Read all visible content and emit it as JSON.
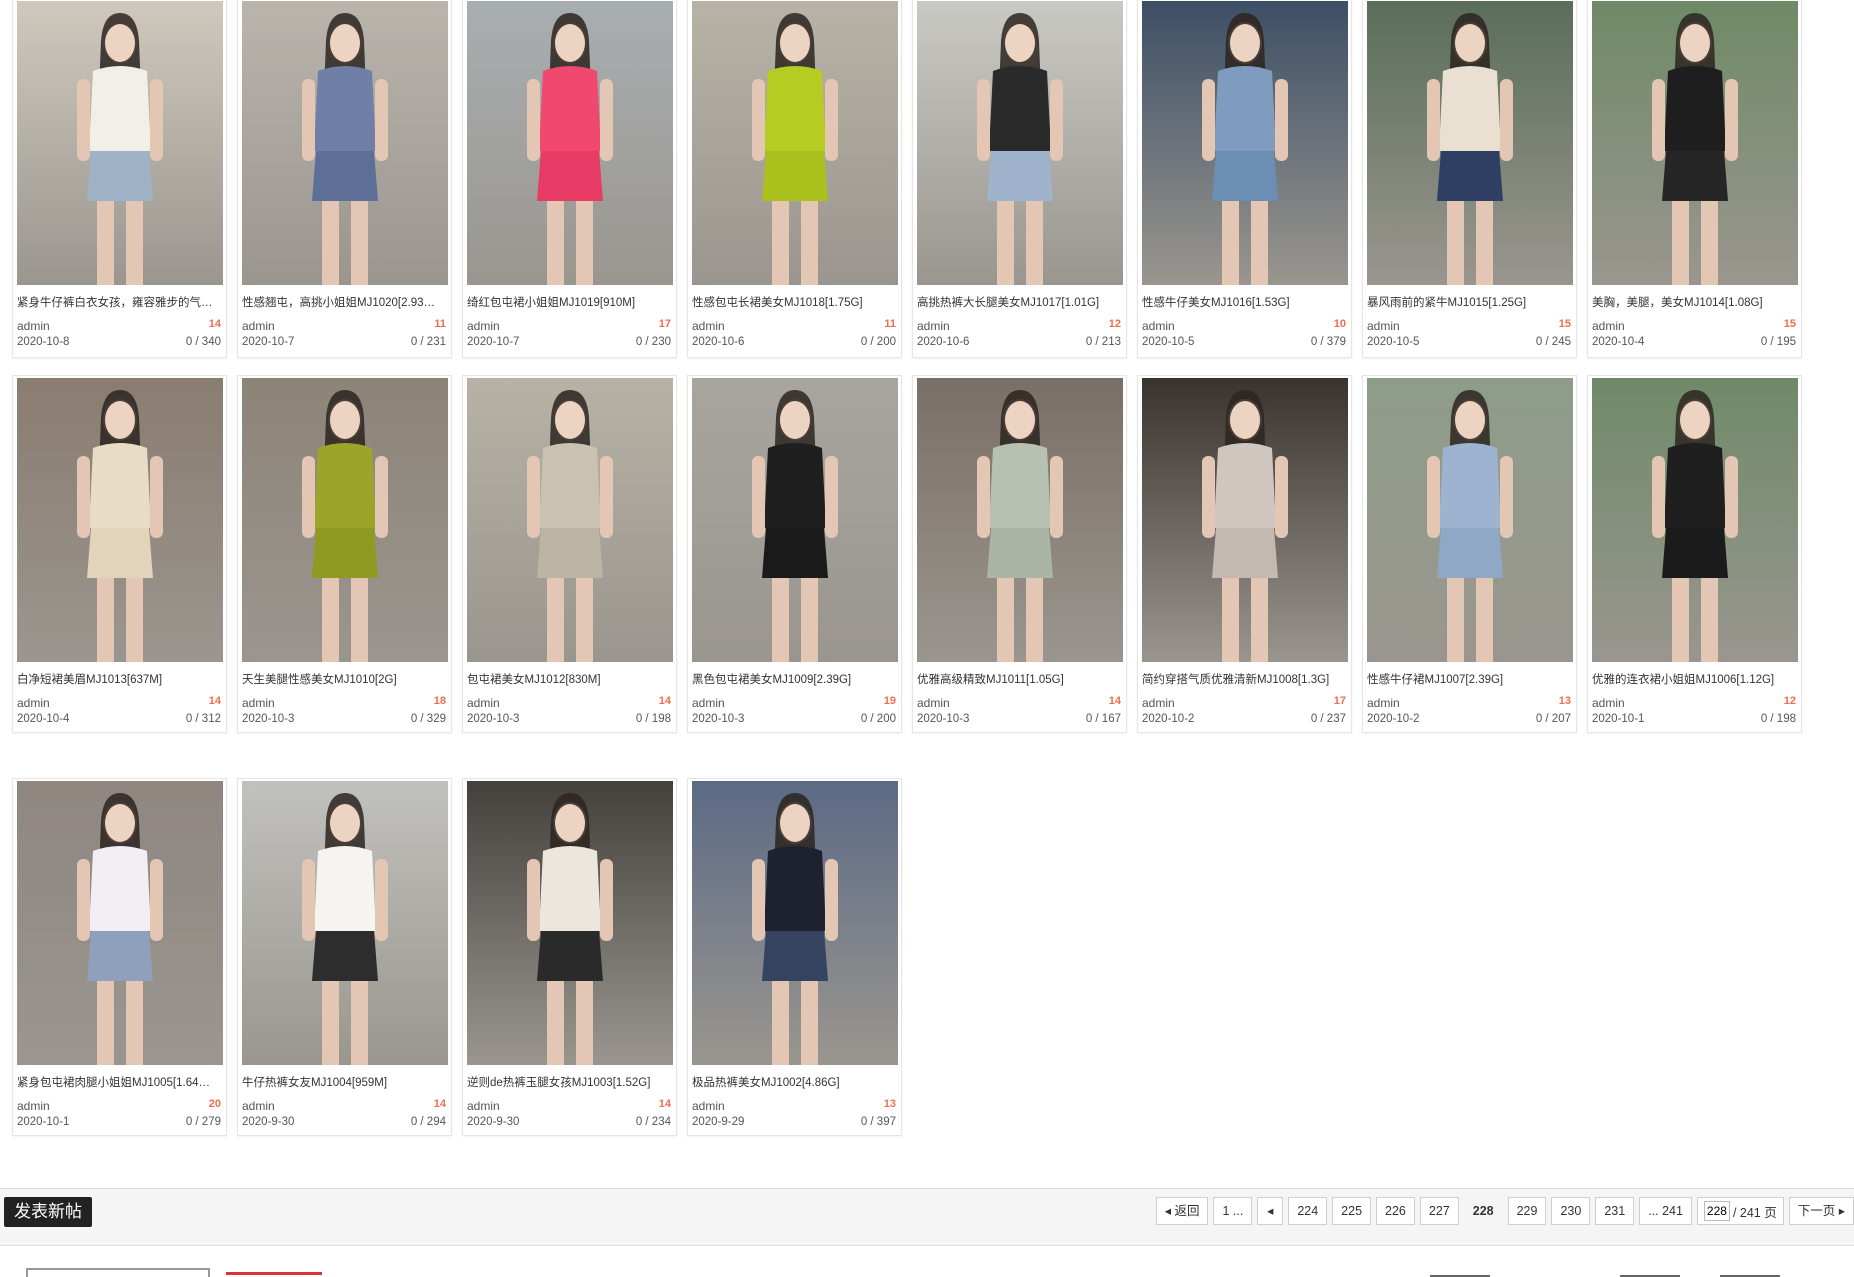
{
  "threads": [
    {
      "title": "紧身牛仔裤白衣女孩，雍容雅步的气…",
      "author": "admin",
      "replies": "14",
      "date": "2020-10-8",
      "views": "0 / 340",
      "thumb_colors": [
        "#cfc8bd",
        "#f2efe9",
        "#9fb2c8"
      ]
    },
    {
      "title": "性感翘屯，高挑小姐姐MJ1020[2.93…",
      "author": "admin",
      "replies": "11",
      "date": "2020-10-7",
      "views": "0 / 231",
      "thumb_colors": [
        "#b9b4ac",
        "#6f7fa6",
        "#5d6f96"
      ]
    },
    {
      "title": "绮红包屯裙小姐姐MJ1019[910M]",
      "author": "admin",
      "replies": "17",
      "date": "2020-10-7",
      "views": "0 / 230",
      "thumb_colors": [
        "#a9aeb1",
        "#f0486f",
        "#e73a64"
      ]
    },
    {
      "title": "性感包屯长裙美女MJ1018[1.75G]",
      "author": "admin",
      "replies": "11",
      "date": "2020-10-6",
      "views": "0 / 200",
      "thumb_colors": [
        "#b8b3a6",
        "#b5cc23",
        "#a9c01d"
      ]
    },
    {
      "title": "高挑热裤大长腿美女MJ1017[1.01G]",
      "author": "admin",
      "replies": "12",
      "date": "2020-10-6",
      "views": "0 / 213",
      "thumb_colors": [
        "#c9c9c4",
        "#2a2a2a",
        "#9fb4cc"
      ]
    },
    {
      "title": "性感牛仔美女MJ1016[1.53G]",
      "author": "admin",
      "replies": "10",
      "date": "2020-10-5",
      "views": "0 / 379",
      "thumb_colors": [
        "#3d4f66",
        "#7f9cc0",
        "#6c8db4"
      ]
    },
    {
      "title": "暴风雨前的紧牛MJ1015[1.25G]",
      "author": "admin",
      "replies": "15",
      "date": "2020-10-5",
      "views": "0 / 245",
      "thumb_colors": [
        "#5a6e5a",
        "#eae0d2",
        "#2e3f63"
      ]
    },
    {
      "title": "美胸，美腿，美女MJ1014[1.08G]",
      "author": "admin",
      "replies": "15",
      "date": "2020-10-4",
      "views": "0 / 195",
      "thumb_colors": [
        "#6f8a66",
        "#1e1e1e",
        "#262626"
      ]
    },
    {
      "title": "白净短裙美眉MJ1013[637M]",
      "author": "admin",
      "replies": "14",
      "date": "2020-10-4",
      "views": "0 / 312",
      "thumb_colors": [
        "#8a7c70",
        "#e9dcc6",
        "#e2d3bb"
      ]
    },
    {
      "title": "天生美腿性感美女MJ1010[2G]",
      "author": "admin",
      "replies": "18",
      "date": "2020-10-3",
      "views": "0 / 329",
      "thumb_colors": [
        "#8d8478",
        "#9aa52a",
        "#8e9a22"
      ]
    },
    {
      "title": "包屯裙美女MJ1012[830M]",
      "author": "admin",
      "replies": "14",
      "date": "2020-10-3",
      "views": "0 / 198",
      "thumb_colors": [
        "#b7b2a5",
        "#c9c2b1",
        "#bdb5a3"
      ]
    },
    {
      "title": "黑色包屯裙美女MJ1009[2.39G]",
      "author": "admin",
      "replies": "19",
      "date": "2020-10-3",
      "views": "0 / 200",
      "thumb_colors": [
        "#a8a59f",
        "#1f1f1f",
        "#1a1a1a"
      ]
    },
    {
      "title": "优雅高级精致MJ1011[1.05G]",
      "author": "admin",
      "replies": "14",
      "date": "2020-10-3",
      "views": "0 / 167",
      "thumb_colors": [
        "#7a6f66",
        "#b6c1b2",
        "#aab5a6"
      ]
    },
    {
      "title": "简约穿搭气质优雅清新MJ1008[1.3G]",
      "author": "admin",
      "replies": "17",
      "date": "2020-10-2",
      "views": "0 / 237",
      "thumb_colors": [
        "#3a332d",
        "#cfc6bf",
        "#c3b9b1"
      ]
    },
    {
      "title": "性感牛仔裙MJ1007[2.39G]",
      "author": "admin",
      "replies": "13",
      "date": "2020-10-2",
      "views": "0 / 207",
      "thumb_colors": [
        "#8e9c8a",
        "#9db3cf",
        "#8fa8c6"
      ]
    },
    {
      "title": "优雅的连衣裙小姐姐MJ1006[1.12G]",
      "author": "admin",
      "replies": "12",
      "date": "2020-10-1",
      "views": "0 / 198",
      "thumb_colors": [
        "#6f8a68",
        "#1f1f1f",
        "#1b1b1b"
      ]
    },
    {
      "title": "紧身包屯裙肉腿小姐姐MJ1005[1.64…",
      "author": "admin",
      "replies": "20",
      "date": "2020-10-1",
      "views": "0 / 279",
      "thumb_colors": [
        "#8f8680",
        "#f2eef3",
        "#8ea0bc"
      ]
    },
    {
      "title": "牛仔热裤女友MJ1004[959M]",
      "author": "admin",
      "replies": "14",
      "date": "2020-9-30",
      "views": "0 / 294",
      "thumb_colors": [
        "#c1c1bd",
        "#f5f4f1",
        "#2d2d2d"
      ]
    },
    {
      "title": "逆则de热裤玉腿女孩MJ1003[1.52G]",
      "author": "admin",
      "replies": "14",
      "date": "2020-9-30",
      "views": "0 / 234",
      "thumb_colors": [
        "#44403c",
        "#ede6dc",
        "#2a2a2a"
      ]
    },
    {
      "title": "极品热裤美女MJ1002[4.86G]",
      "author": "admin",
      "replies": "13",
      "date": "2020-9-29",
      "views": "0 / 397",
      "thumb_colors": [
        "#5c6a85",
        "#1e2230",
        "#35435f"
      ]
    }
  ],
  "new_post_label": "发表新帖",
  "pagination": {
    "back": "返回",
    "first": "1 ...",
    "prev_icon": "chevron-left-icon",
    "pages": [
      "224",
      "225",
      "226",
      "227",
      "228",
      "229",
      "230",
      "231"
    ],
    "current": "228",
    "last": "... 241",
    "input_value": "228",
    "total": "/ 241 页",
    "next": "下一页"
  },
  "colors": {
    "accent_red": "#f26c4f",
    "dark_button": "#222222",
    "bar_bg": "#f5f5f5"
  }
}
